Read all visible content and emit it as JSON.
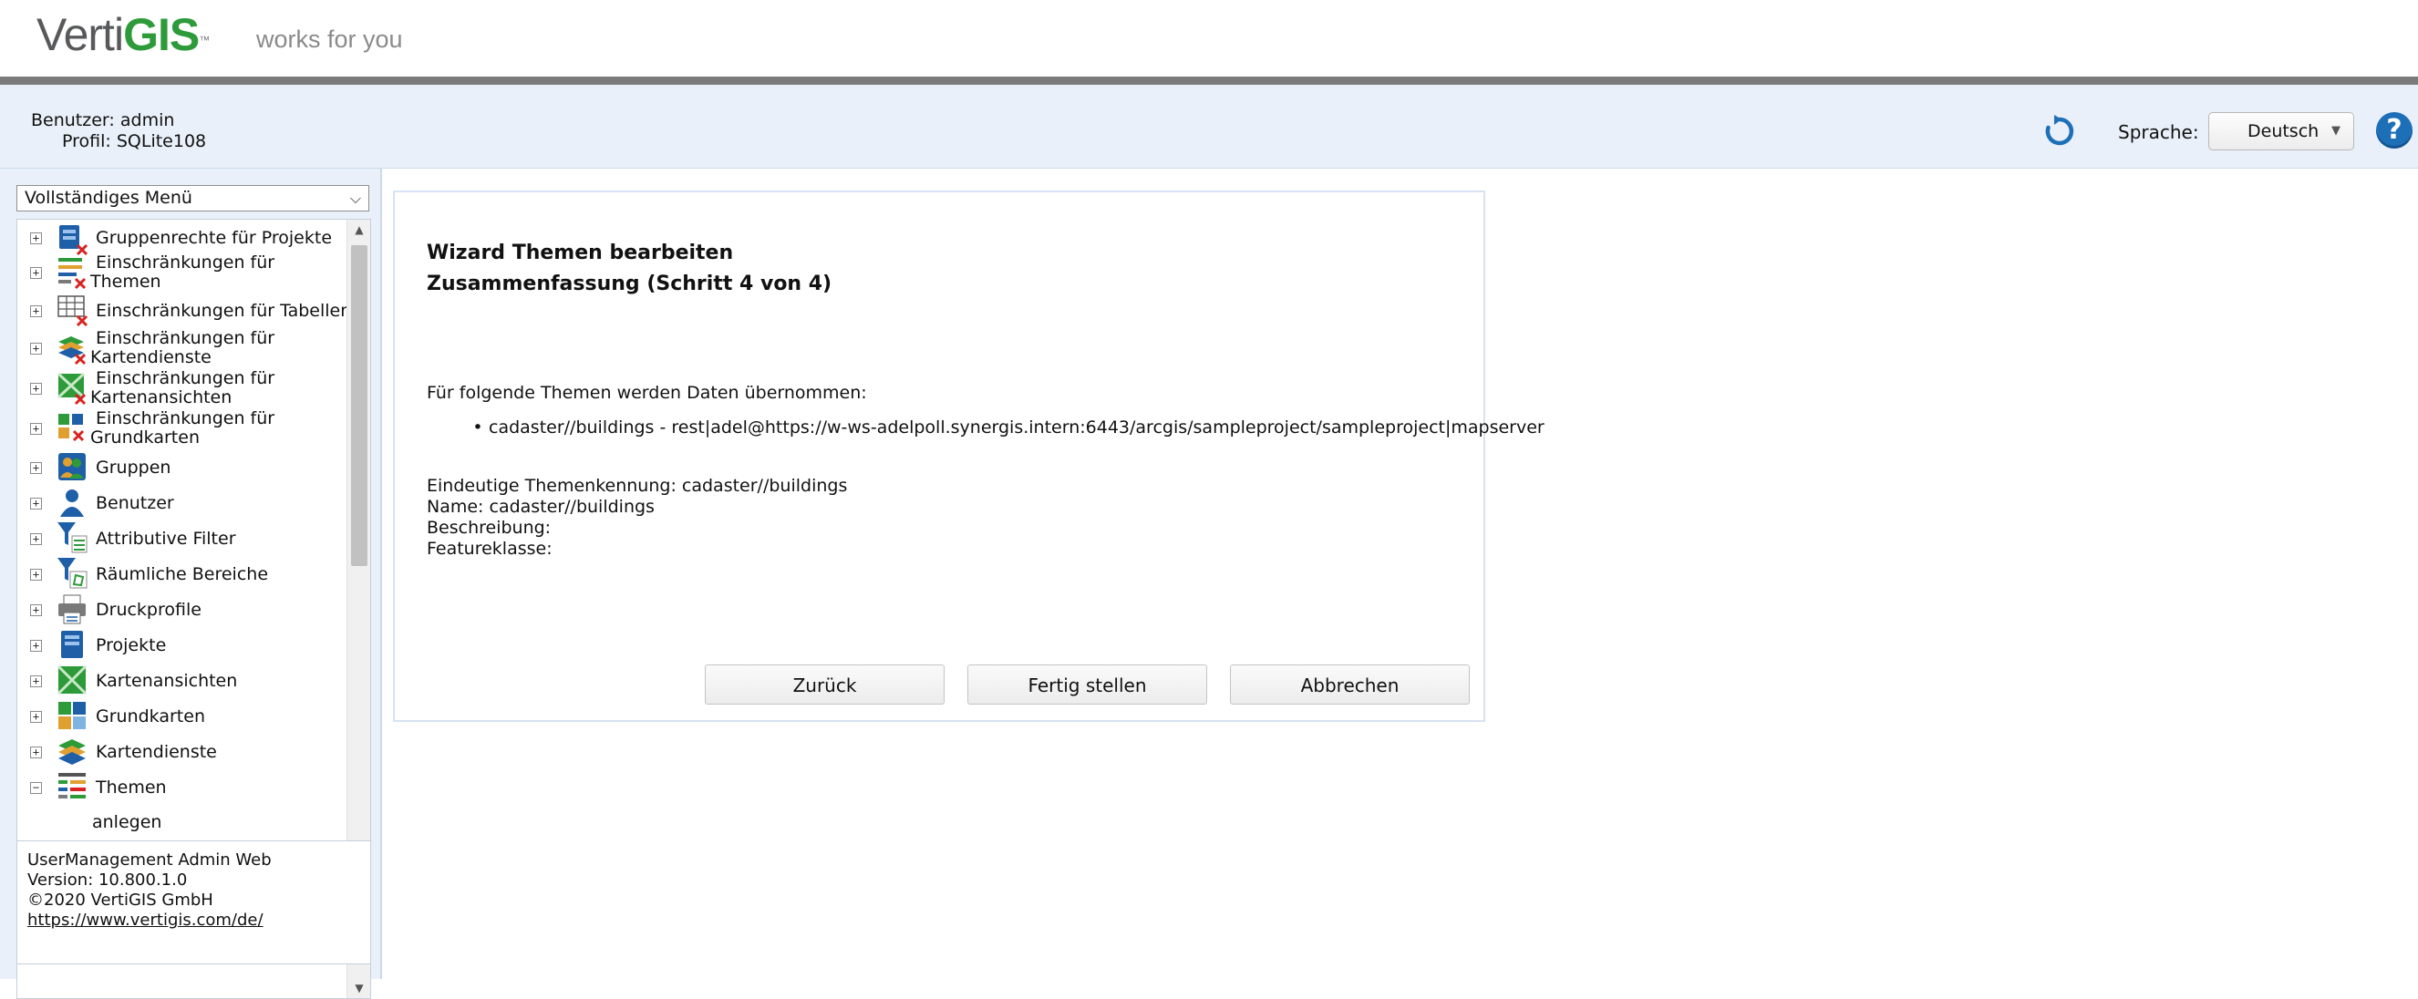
{
  "brand": {
    "logo_part1": "Verti",
    "logo_part2": "GIS",
    "trademark": "™",
    "tagline": "works for you"
  },
  "user": {
    "user_label": "Benutzer:",
    "user_value": "admin",
    "profile_label": "Profil:",
    "profile_value": "SQLite108"
  },
  "header": {
    "refresh_icon": "refresh-icon",
    "language_label": "Sprache:",
    "language_value": "Deutsch",
    "help_glyph": "?"
  },
  "menu": {
    "selected": "Vollständiges Menü",
    "items": [
      {
        "label": "Gruppenrechte für Projekte",
        "icon": "group-rights-projects-icon",
        "expander": "+"
      },
      {
        "line1": "Einschränkungen für",
        "line2": "Themen",
        "icon": "restrictions-themes-icon",
        "expander": "+"
      },
      {
        "label": "Einschränkungen für Tabellen",
        "icon": "restrictions-tables-icon",
        "expander": "+"
      },
      {
        "line1": "Einschränkungen für",
        "line2": "Kartendienste",
        "icon": "restrictions-map-services-icon",
        "expander": "+"
      },
      {
        "line1": "Einschränkungen für",
        "line2": "Kartenansichten",
        "icon": "restrictions-map-views-icon",
        "expander": "+"
      },
      {
        "line1": "Einschränkungen für",
        "line2": "Grundkarten",
        "icon": "restrictions-basemaps-icon",
        "expander": "+"
      },
      {
        "label": "Gruppen",
        "icon": "groups-icon",
        "expander": "+"
      },
      {
        "label": "Benutzer",
        "icon": "user-icon",
        "expander": "+"
      },
      {
        "label": "Attributive Filter",
        "icon": "attribute-filter-icon",
        "expander": "+"
      },
      {
        "label": "Räumliche Bereiche",
        "icon": "spatial-areas-icon",
        "expander": "+"
      },
      {
        "label": "Druckprofile",
        "icon": "printer-icon",
        "expander": "+"
      },
      {
        "label": "Projekte",
        "icon": "projects-icon",
        "expander": "+"
      },
      {
        "label": "Kartenansichten",
        "icon": "map-views-icon",
        "expander": "+"
      },
      {
        "label": "Grundkarten",
        "icon": "basemaps-icon",
        "expander": "+"
      },
      {
        "label": "Kartendienste",
        "icon": "map-services-icon",
        "expander": "+"
      },
      {
        "label": "Themen",
        "icon": "themes-icon",
        "expander": "−"
      }
    ],
    "sub_item": "anlegen"
  },
  "info": {
    "app_name": "UserManagement Admin Web",
    "version": "Version: 10.800.1.0",
    "copyright": "©2020 VertiGIS GmbH",
    "link": "https://www.vertigis.com/de/"
  },
  "wizard": {
    "title_line1": "Wizard Themen bearbeiten",
    "title_line2": "Zusammenfassung (Schritt 4 von 4)",
    "intro": "Für folgende Themen werden Daten übernommen:",
    "themes": [
      "cadaster//buildings - rest|adel@https://w-ws-adelpoll.synergis.intern:6443/arcgis/sampleproject/sampleproject|mapserver"
    ],
    "details": [
      "Eindeutige Themenkennung: cadaster//buildings",
      "Name: cadaster//buildings",
      "Beschreibung:",
      "Featureklasse:"
    ],
    "buttons": {
      "back": "Zurück",
      "finish": "Fertig stellen",
      "cancel": "Abbrechen"
    }
  },
  "colors": {
    "brand_green": "#2e9b3a",
    "panel_bg": "#e9f0f9",
    "accent_blue": "#1d6fb8"
  }
}
